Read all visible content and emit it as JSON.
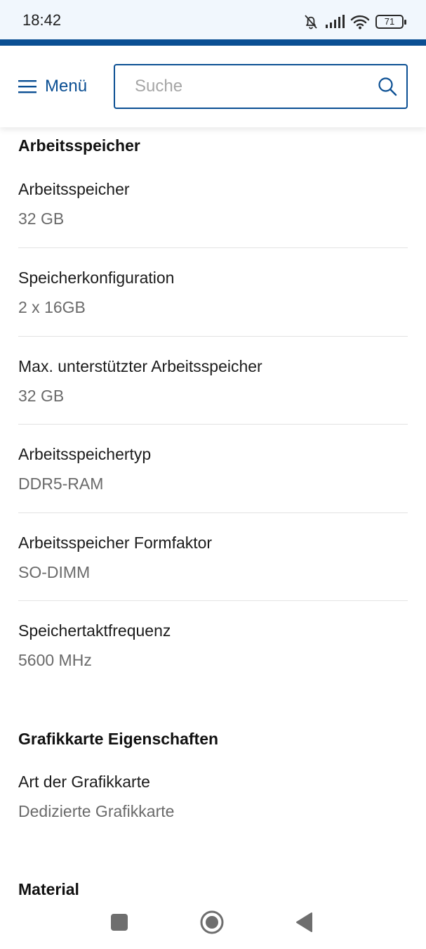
{
  "status_bar": {
    "time": "18:42",
    "battery": "71",
    "icons": [
      "bell-off-icon",
      "signal-icon",
      "wifi-icon",
      "battery-icon"
    ]
  },
  "header": {
    "menu_label": "Menü",
    "search_placeholder": "Suche",
    "brand_color": "#0b4f93"
  },
  "sections": {
    "memory": {
      "title": "Arbeitsspeicher",
      "items": [
        {
          "label": "Arbeitsspeicher",
          "value": "32 GB"
        },
        {
          "label": "Speicherkonfiguration",
          "value": "2 x 16GB"
        },
        {
          "label": "Max. unterstützter Arbeitsspeicher",
          "value": "32 GB"
        },
        {
          "label": "Arbeitsspeichertyp",
          "value": "DDR5-RAM"
        },
        {
          "label": "Arbeitsspeicher Formfaktor",
          "value": "SO-DIMM"
        },
        {
          "label": "Speichertaktfrequenz",
          "value": "5600 MHz"
        }
      ]
    },
    "graphics": {
      "title": "Grafikkarte Eigenschaften",
      "items": [
        {
          "label": "Art der Grafikkarte",
          "value": "Dedizierte Grafikkarte"
        }
      ]
    },
    "material": {
      "title": "Material"
    }
  },
  "nav_bar": {
    "icons": [
      "recent-apps-icon",
      "home-icon",
      "back-icon"
    ]
  }
}
